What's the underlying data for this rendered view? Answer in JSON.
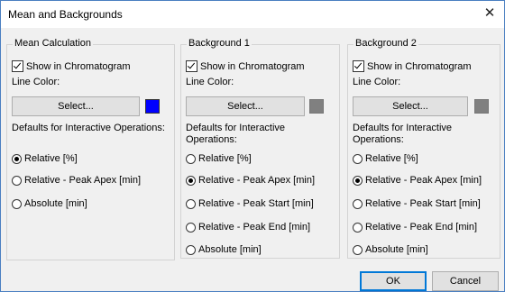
{
  "window": {
    "title": "Mean and Backgrounds",
    "close_glyph": "✕"
  },
  "groups": [
    {
      "legend": "Mean Calculation",
      "show_label": "Show in Chromatogram",
      "show_checked": true,
      "line_color_label": "Line Color:",
      "select_label": "Select...",
      "swatch_color": "#0000ff",
      "defaults_label": "Defaults for Interactive Operations:",
      "options": [
        {
          "label": "Relative [%]",
          "selected": true
        },
        {
          "label": "Relative - Peak Apex [min]",
          "selected": false
        },
        {
          "label": "Absolute [min]",
          "selected": false
        }
      ]
    },
    {
      "legend": "Background 1",
      "show_label": "Show in Chromatogram",
      "show_checked": true,
      "line_color_label": "Line Color:",
      "select_label": "Select...",
      "swatch_color": "#808080",
      "defaults_label": "Defaults for Interactive Operations:",
      "options": [
        {
          "label": "Relative [%]",
          "selected": false
        },
        {
          "label": "Relative - Peak Apex [min]",
          "selected": true
        },
        {
          "label": "Relative - Peak Start [min]",
          "selected": false
        },
        {
          "label": "Relative - Peak End [min]",
          "selected": false
        },
        {
          "label": "Absolute [min]",
          "selected": false
        }
      ]
    },
    {
      "legend": "Background 2",
      "show_label": "Show in Chromatogram",
      "show_checked": true,
      "line_color_label": "Line Color:",
      "select_label": "Select...",
      "swatch_color": "#808080",
      "defaults_label": "Defaults for Interactive Operations:",
      "options": [
        {
          "label": "Relative [%]",
          "selected": false
        },
        {
          "label": "Relative - Peak Apex [min]",
          "selected": true
        },
        {
          "label": "Relative - Peak Start [min]",
          "selected": false
        },
        {
          "label": "Relative - Peak End [min]",
          "selected": false
        },
        {
          "label": "Absolute [min]",
          "selected": false
        }
      ]
    }
  ],
  "footer": {
    "ok_label": "OK",
    "cancel_label": "Cancel"
  }
}
